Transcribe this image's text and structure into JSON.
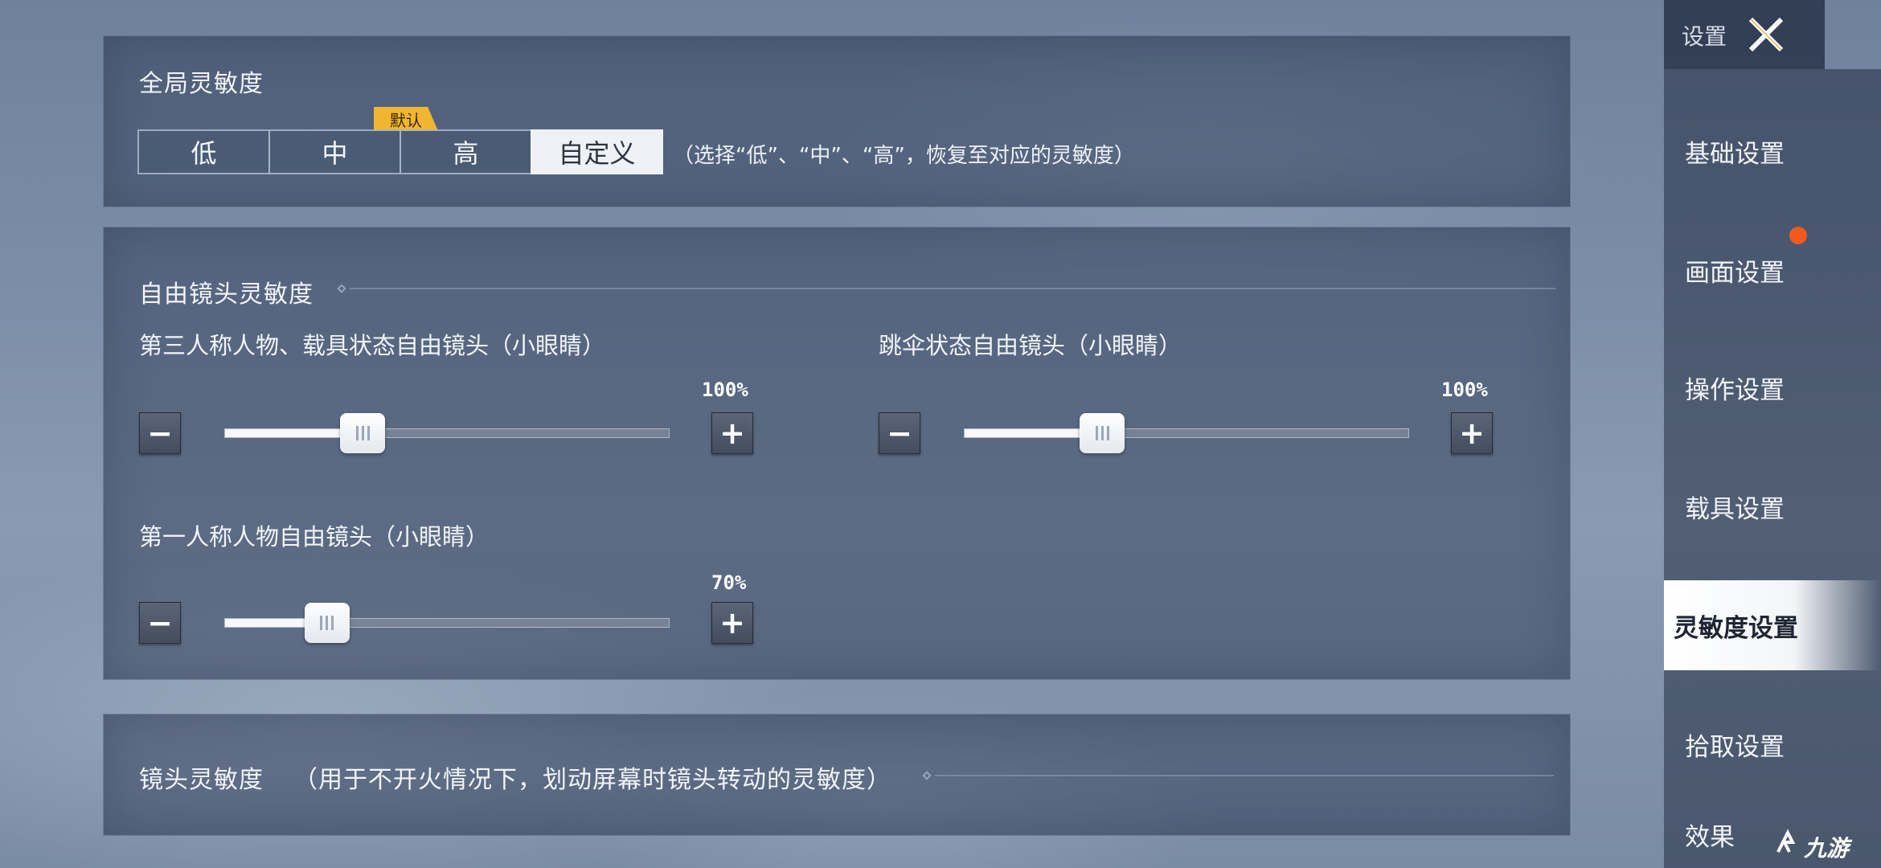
{
  "global": {
    "title": "全局灵敏度",
    "default_tag": "默认",
    "options": [
      "低",
      "中",
      "高",
      "自定义"
    ],
    "selected": "自定义",
    "hint": "（选择“低”、“中”、“高”，恢复至对应的灵敏度）"
  },
  "free_camera": {
    "title": "自由镜头灵敏度",
    "sliders": [
      {
        "label": "第三人称人物、载具状态自由镜头（小眼睛）",
        "value_text": "100%",
        "level": 0.31
      },
      {
        "label": "跳伞状态自由镜头（小眼睛）",
        "value_text": "100%",
        "level": 0.31
      },
      {
        "label": "第一人称人物自由镜头（小眼睛）",
        "value_text": "70%",
        "level": 0.23
      }
    ],
    "minus": "−",
    "plus": "+"
  },
  "camera": {
    "title": "镜头灵敏度",
    "subtitle": "（用于不开火情况下，划动屏幕时镜头转动的灵敏度）"
  },
  "sidebar": {
    "title": "设置",
    "items": [
      "基础设置",
      "画面设置",
      "操作设置",
      "载具设置",
      "灵敏度设置",
      "拾取设置",
      "效果"
    ],
    "active": "灵敏度设置"
  },
  "watermark": "九游",
  "colors": {
    "accent_tag": "#f0b531",
    "notify": "#ef5a1f"
  }
}
